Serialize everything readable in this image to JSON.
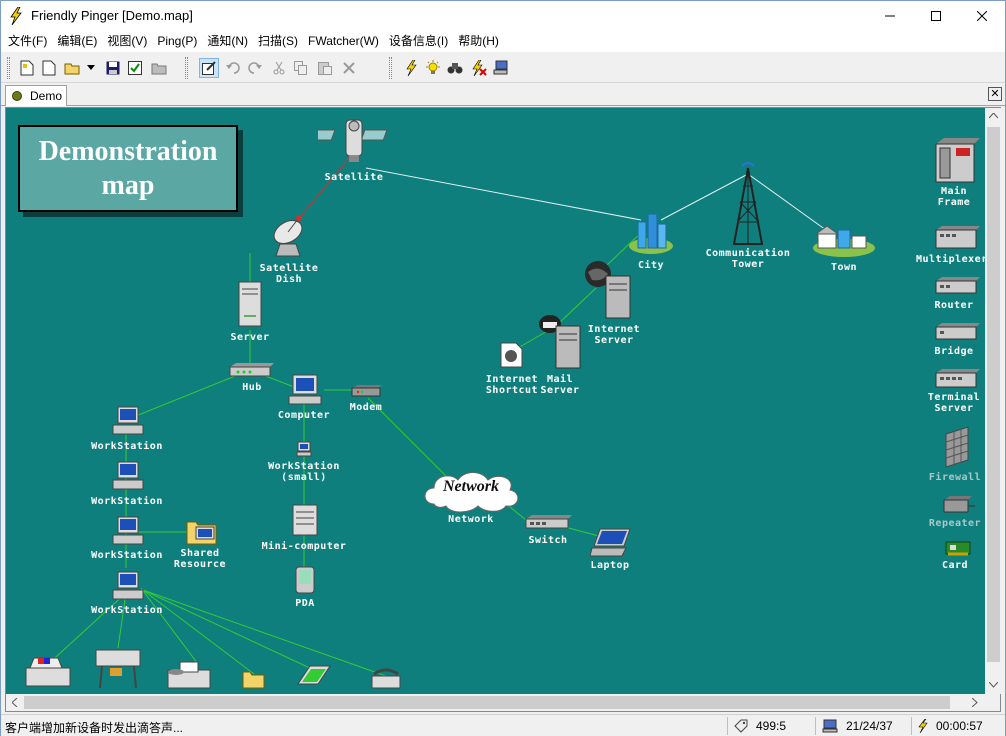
{
  "window": {
    "title": "Friendly Pinger [Demo.map]",
    "minimize": "—",
    "maximize": "☐",
    "close": "✕"
  },
  "menu": [
    "文件(F)",
    "编辑(E)",
    "视图(V)",
    "Ping(P)",
    "通知(N)",
    "扫描(S)",
    "FWatcher(W)",
    "设备信息(I)",
    "帮助(H)"
  ],
  "tab": {
    "label": "Demo",
    "close": "✕"
  },
  "map": {
    "title": "Demonstration map",
    "cloud_text": "Network",
    "nodes": {
      "satellite": "Satellite",
      "satellite_dish": "Satellite\nDish",
      "server": "Server",
      "hub": "Hub",
      "computer": "Computer",
      "modem": "Modem",
      "workstation_small": "WorkStation\n(small)",
      "mini_computer": "Mini-computer",
      "pda": "PDA",
      "workstation1": "WorkStation",
      "workstation2": "WorkStation",
      "workstation3": "WorkStation",
      "workstation4": "WorkStation",
      "shared_resource": "Shared\nResource",
      "network": "Network",
      "switch": "Switch",
      "laptop": "Laptop",
      "city": "City",
      "communication_tower": "Communication\nTower",
      "town": "Town",
      "internet_server": "Internet\nServer",
      "internet_shortcut": "Internet\nShortcut",
      "mail_server": "Mail\nServer",
      "main_frame": "Main\nFrame",
      "multiplexer": "Multiplexer",
      "router": "Router",
      "bridge": "Bridge",
      "terminal_server": "Terminal\nServer",
      "firewall": "Firewall",
      "repeater": "Repeater",
      "card": "Card"
    }
  },
  "status": {
    "message": "客户端增加新设备时发出滴答声...",
    "counter": "499:5",
    "hosts": "21/24/37",
    "time": "00:00:57"
  },
  "colors": {
    "map_background": "#0f7f7d",
    "link_green": "#33cc33",
    "link_white": "#e0f0f0",
    "link_red": "#d03030",
    "title_box": "#5aa7a3"
  }
}
